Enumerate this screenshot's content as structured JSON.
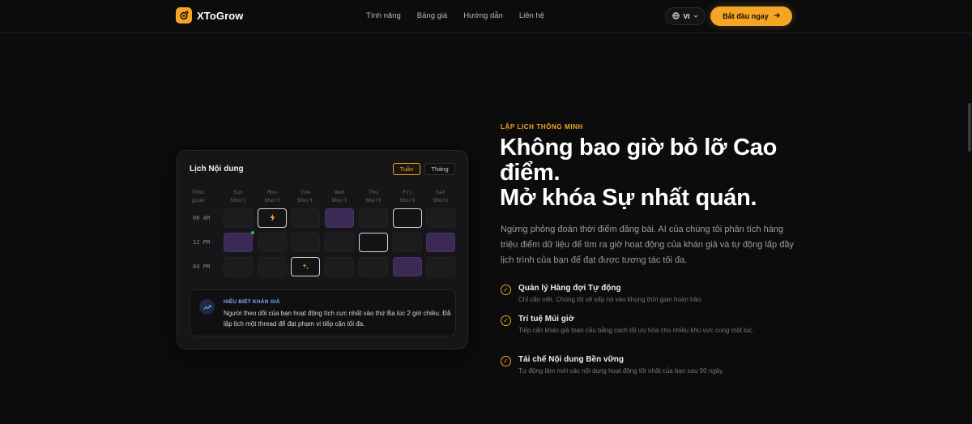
{
  "nav": {
    "brand": "XToGrow",
    "links": [
      "Tính năng",
      "Bảng giá",
      "Hướng dẫn",
      "Liên hệ"
    ],
    "lang": "VI",
    "cta": "Bắt đầu ngay"
  },
  "calendar": {
    "title": "Lịch Nội dung",
    "tab_week": "Tuần",
    "tab_month": "Tháng",
    "time_header": [
      "Thời",
      "gian"
    ],
    "days": [
      {
        "name": "Sun",
        "sub": "Short"
      },
      {
        "name": "Mon",
        "sub": "Short"
      },
      {
        "name": "Tue",
        "sub": "Short"
      },
      {
        "name": "Wed",
        "sub": "Short"
      },
      {
        "name": "Thu",
        "sub": "Short"
      },
      {
        "name": "Fri",
        "sub": "Short"
      },
      {
        "name": "Sat",
        "sub": "Short"
      }
    ],
    "rows": [
      {
        "time": "08 AM",
        "cells": [
          "empty",
          "outlined-bolt",
          "empty",
          "purple",
          "empty",
          "outlined",
          "empty"
        ]
      },
      {
        "time": "12 PM",
        "cells": [
          "purple-dot",
          "empty",
          "empty",
          "empty",
          "outlined",
          "empty",
          "purple"
        ]
      },
      {
        "time": "04 PM",
        "cells": [
          "empty",
          "empty",
          "outlined-spark",
          "empty",
          "empty",
          "purple",
          "empty"
        ]
      }
    ],
    "insight_label": "HIỂU BIẾT KHÁN GIẢ",
    "insight_text": "Người theo dõi của bạn hoạt động tích cực nhất vào thứ Ba lúc 2 giờ chiều. Đã lập lịch một thread để đạt phạm vi tiếp cận tối đa."
  },
  "hero": {
    "eyebrow": "LẬP LỊCH THÔNG MINH",
    "headline_line1": "Không bao giờ bỏ lỡ Cao điểm.",
    "headline_line2": "Mở khóa Sự nhất quán.",
    "lead": "Ngừng phỏng đoán thời điểm đăng bài. AI của chúng tôi phân tích hàng triệu điểm dữ liệu để tìm ra giờ hoạt động của khán giả và tự động lấp đầy lịch trình của bạn để đạt được tương tác tối đa.",
    "features": [
      {
        "title": "Quản lý Hàng đợi Tự động",
        "desc": "Chỉ cần viết. Chúng tôi sẽ xếp nó vào khung thời gian hoàn hảo."
      },
      {
        "title": "Trí tuệ Múi giờ",
        "desc": "Tiếp cận khán giả toàn cầu bằng cách tối ưu hóa cho nhiều khu vực cùng một lúc."
      },
      {
        "title": "Tái chế Nội dung Bền vững",
        "desc": "Tự động làm mới các nội dung hoạt động tốt nhất của bạn sau 90 ngày."
      }
    ]
  },
  "colors": {
    "accent": "#f5a524",
    "background": "#0c0c0d",
    "purple_slot": "#3a2a55",
    "insight_blue": "#7aa8ff",
    "dot_green": "#22c55e"
  },
  "icons": [
    "brand-logo-icon",
    "globe-icon",
    "chevron-down-icon",
    "arrow-right-icon",
    "bolt-icon",
    "sparkle-icon",
    "trend-icon",
    "check-circle-icon"
  ]
}
